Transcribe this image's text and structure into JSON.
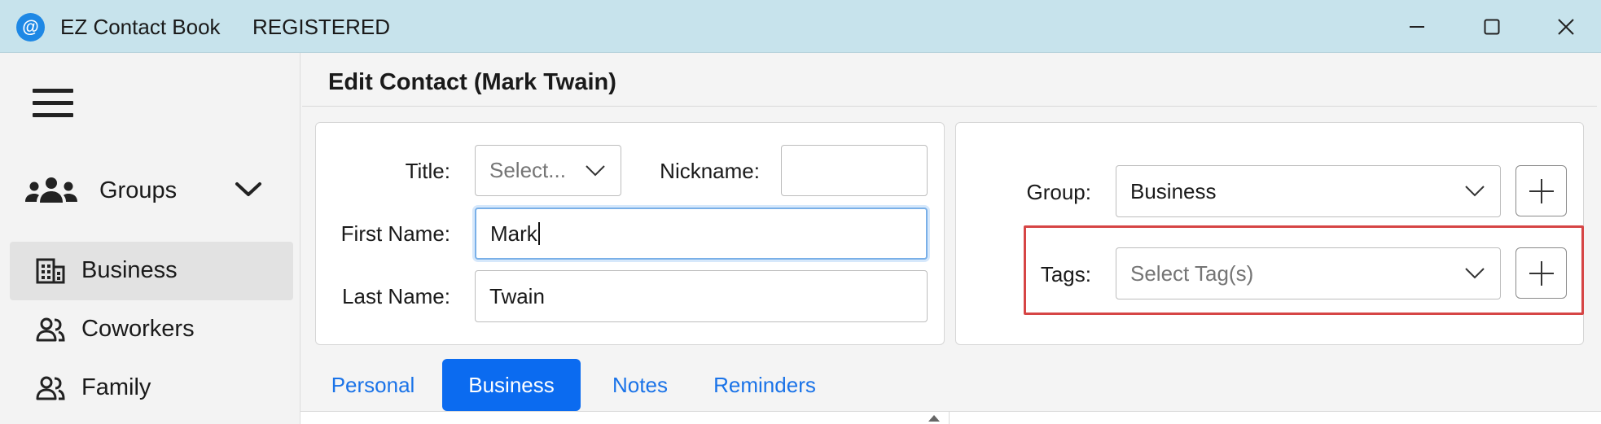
{
  "window": {
    "app_icon_glyph": "@",
    "title": "EZ Contact Book",
    "status": "REGISTERED"
  },
  "sidebar": {
    "groups_label": "Groups",
    "items": [
      {
        "label": "Business",
        "icon": "building-icon",
        "selected": true
      },
      {
        "label": "Coworkers",
        "icon": "people-icon",
        "selected": false
      },
      {
        "label": "Family",
        "icon": "people-icon",
        "selected": false
      }
    ]
  },
  "main": {
    "title": "Edit Contact (Mark Twain)",
    "form": {
      "title_label": "Title:",
      "title_placeholder": "Select...",
      "nickname_label": "Nickname:",
      "nickname_value": "",
      "first_name_label": "First Name:",
      "first_name_value": "Mark",
      "last_name_label": "Last Name:",
      "last_name_value": "Twain",
      "group_label": "Group:",
      "group_value": "Business",
      "tags_label": "Tags:",
      "tags_placeholder": "Select Tag(s)"
    },
    "tabs": [
      {
        "label": "Personal",
        "active": false
      },
      {
        "label": "Business",
        "active": true
      },
      {
        "label": "Notes",
        "active": false
      },
      {
        "label": "Reminders",
        "active": false
      }
    ]
  },
  "colors": {
    "titlebar": "#c7e3ec",
    "accent": "#0b6bf0",
    "link": "#1a73e8",
    "highlight": "#d64545"
  }
}
